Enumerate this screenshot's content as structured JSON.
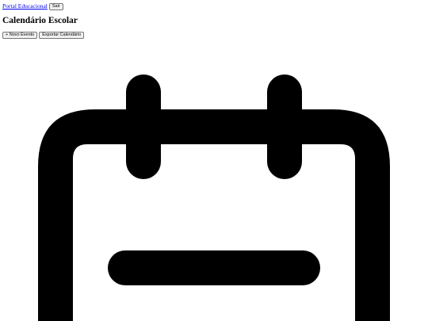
{
  "header": {
    "portal_link": "Portal Educacional",
    "logout_label": "Sair"
  },
  "page": {
    "title": "Calendário Escolar"
  },
  "toolbar": {
    "new_event_label": "+ Novo Evento",
    "export_label": "Exportar Calendário"
  },
  "graphic": {
    "icon": "calendar-icon",
    "color": "#000000"
  }
}
